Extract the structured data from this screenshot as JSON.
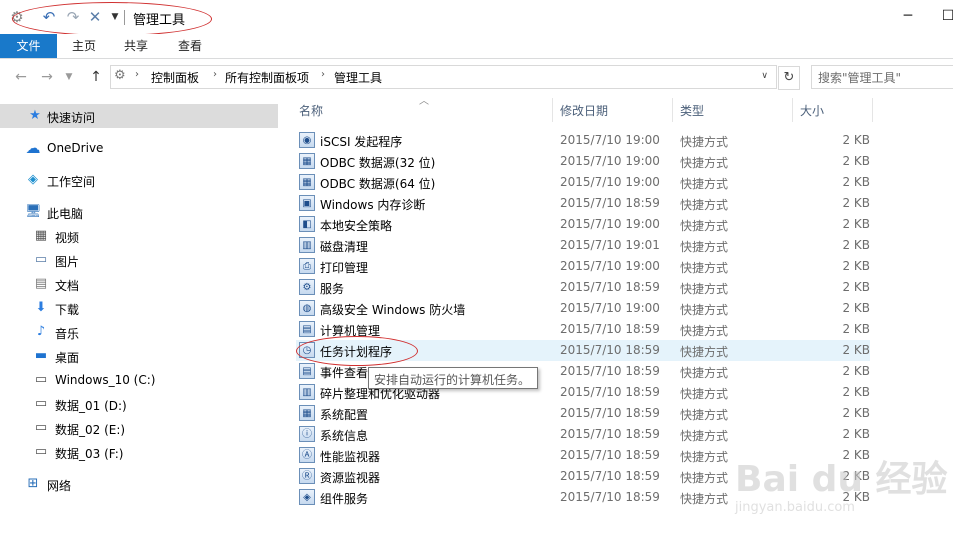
{
  "window": {
    "title": "管理工具",
    "qat_icons": [
      "properties-icon",
      "undo-icon",
      "redo-icon",
      "delete-icon",
      "customize-dropdown-icon"
    ],
    "controls": [
      "minimize-icon",
      "maximize-icon"
    ]
  },
  "ribbon": {
    "tabs": [
      {
        "label": "文件",
        "active": true
      },
      {
        "label": "主页"
      },
      {
        "label": "共享"
      },
      {
        "label": "查看"
      }
    ]
  },
  "address": {
    "crumbs": [
      "控制面板",
      "所有控制面板项",
      "管理工具"
    ],
    "search_placeholder": "搜索\"管理工具\""
  },
  "sidebar": {
    "items": [
      {
        "label": "快速访问",
        "icon": "star-icon"
      },
      {
        "label": "OneDrive",
        "icon": "cloud-icon"
      },
      {
        "label": "工作空间",
        "icon": "workspace-icon"
      },
      {
        "label": "此电脑",
        "icon": "computer-icon"
      },
      {
        "label": "视频",
        "icon": "video-icon"
      },
      {
        "label": "图片",
        "icon": "pictures-icon"
      },
      {
        "label": "文档",
        "icon": "documents-icon"
      },
      {
        "label": "下载",
        "icon": "download-icon"
      },
      {
        "label": "音乐",
        "icon": "music-icon"
      },
      {
        "label": "桌面",
        "icon": "desktop-icon"
      },
      {
        "label": "Windows_10 (C:)",
        "icon": "drive-icon"
      },
      {
        "label": "数据_01 (D:)",
        "icon": "drive-icon"
      },
      {
        "label": "数据_02 (E:)",
        "icon": "drive-icon"
      },
      {
        "label": "数据_03 (F:)",
        "icon": "drive-icon"
      },
      {
        "label": "网络",
        "icon": "network-icon"
      }
    ]
  },
  "columns": {
    "name": "名称",
    "date": "修改日期",
    "type": "类型",
    "size": "大小"
  },
  "files": [
    {
      "name": "iSCSI 发起程序",
      "date": "2015/7/10 19:00",
      "type": "快捷方式",
      "size": "2 KB"
    },
    {
      "name": "ODBC 数据源(32 位)",
      "date": "2015/7/10 19:00",
      "type": "快捷方式",
      "size": "2 KB"
    },
    {
      "name": "ODBC 数据源(64 位)",
      "date": "2015/7/10 19:00",
      "type": "快捷方式",
      "size": "2 KB"
    },
    {
      "name": "Windows 内存诊断",
      "date": "2015/7/10 18:59",
      "type": "快捷方式",
      "size": "2 KB"
    },
    {
      "name": "本地安全策略",
      "date": "2015/7/10 19:00",
      "type": "快捷方式",
      "size": "2 KB"
    },
    {
      "name": "磁盘清理",
      "date": "2015/7/10 19:01",
      "type": "快捷方式",
      "size": "2 KB"
    },
    {
      "name": "打印管理",
      "date": "2015/7/10 19:00",
      "type": "快捷方式",
      "size": "2 KB"
    },
    {
      "name": "服务",
      "date": "2015/7/10 18:59",
      "type": "快捷方式",
      "size": "2 KB"
    },
    {
      "name": "高级安全 Windows 防火墙",
      "date": "2015/7/10 19:00",
      "type": "快捷方式",
      "size": "2 KB"
    },
    {
      "name": "计算机管理",
      "date": "2015/7/10 18:59",
      "type": "快捷方式",
      "size": "2 KB"
    },
    {
      "name": "任务计划程序",
      "date": "2015/7/10 18:59",
      "type": "快捷方式",
      "size": "2 KB",
      "selected": true
    },
    {
      "name": "事件查看器",
      "date": "2015/7/10 18:59",
      "type": "快捷方式",
      "size": "2 KB"
    },
    {
      "name": "碎片整理和优化驱动器",
      "date": "2015/7/10 18:59",
      "type": "快捷方式",
      "size": "2 KB"
    },
    {
      "name": "系统配置",
      "date": "2015/7/10 18:59",
      "type": "快捷方式",
      "size": "2 KB"
    },
    {
      "name": "系统信息",
      "date": "2015/7/10 18:59",
      "type": "快捷方式",
      "size": "2 KB"
    },
    {
      "name": "性能监视器",
      "date": "2015/7/10 18:59",
      "type": "快捷方式",
      "size": "2 KB"
    },
    {
      "name": "资源监视器",
      "date": "2015/7/10 18:59",
      "type": "快捷方式",
      "size": "2 KB"
    },
    {
      "name": "组件服务",
      "date": "2015/7/10 18:59",
      "type": "快捷方式",
      "size": "2 KB"
    }
  ],
  "tooltip": "安排自动运行的计算机任务。",
  "watermark": {
    "logo": "Bai du 经验",
    "url": "jingyan.baidu.com"
  },
  "colors": {
    "accent": "#1979ca",
    "annotation": "#d03030",
    "selection": "#e5f3fb"
  }
}
